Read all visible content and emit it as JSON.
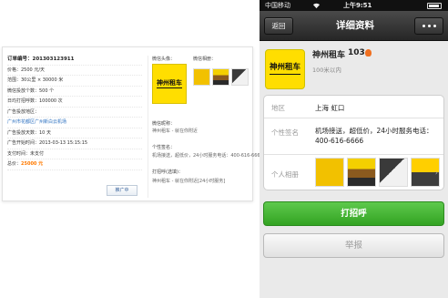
{
  "order_panel": {
    "rows": [
      "订单编号：201303123911",
      "价格：2500 元/天",
      "范围：30公里 × 30000 米",
      "微信投放个数：500 个",
      "日均打招呼数：100000 次",
      "广告投放地区：",
      "广州市花都区广州新白云机场",
      "广告投放天数：10 天",
      "广告开始时间：2013-03-13 15:15:15",
      "支付时间：未支付"
    ],
    "total_label": "总价：",
    "total_value": "25000 元",
    "ad_button": "推广中",
    "wx_avatar_label": "微信头像：",
    "wx_photos_label": "微信相册：",
    "wx_name_label": "微信昵称：",
    "wx_name_value": "神州租车 - 就在你附近",
    "wx_sig_label": "个性签名：",
    "wx_sig_value": "机场接送，超低价，24小时服务电话：400-616-6666...",
    "wx_contact_label": "打招呼(选填)：",
    "wx_contact_value": "神州租车 - 就在你附近[24小时服务]"
  },
  "logo": {
    "brand_text": "神州租车",
    "color": "#ffde00"
  },
  "phone": {
    "status": {
      "carrier": "中国移动",
      "time": "上午9:51"
    },
    "nav": {
      "back_label": "返回",
      "title": "详细资料"
    },
    "profile": {
      "name": "神州租车",
      "name_suffix": "103",
      "distance": "100米以内"
    },
    "details": {
      "region_label": "地区",
      "region_value": "上海  虹口",
      "sig_label": "个性签名",
      "sig_value": "机场接送，超低价，24小时服务电话：400-616-6666",
      "album_label": "个人相册",
      "album_chevron": "›"
    },
    "call_button": "打招呼",
    "report_button": "举报",
    "colors": {
      "call_green": "#3fb52e",
      "nav_dark": "#2e2e2e"
    }
  }
}
